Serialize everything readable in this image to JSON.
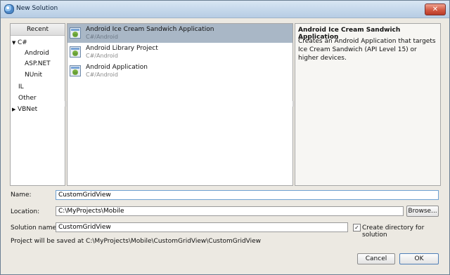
{
  "window": {
    "title": "New Solution",
    "close_glyph": "✕"
  },
  "categories": {
    "header": "Recent",
    "items": [
      {
        "label": "C#",
        "expander": "▼"
      },
      {
        "label": "Android"
      },
      {
        "label": "ASP.NET"
      },
      {
        "label": "NUnit"
      },
      {
        "label": "IL"
      },
      {
        "label": "Other"
      },
      {
        "label": "VBNet",
        "expander": "▶"
      }
    ]
  },
  "templates": [
    {
      "name": "Android Ice Cream Sandwich Application",
      "subtitle": "C#/Android",
      "selected": true,
      "icon": "android-project-icon"
    },
    {
      "name": "Android Library Project",
      "subtitle": "C#/Android",
      "selected": false,
      "icon": "android-project-icon"
    },
    {
      "name": "Android Application",
      "subtitle": "C#/Android",
      "selected": false,
      "icon": "android-project-icon"
    }
  ],
  "description": {
    "title": "Android Ice Cream Sandwich Application",
    "text": "Creates an Android Application that targets Ice Cream Sandwich (API Level 15) or higher devices."
  },
  "form": {
    "name_label": "Name:",
    "name_value": "CustomGridView",
    "location_label": "Location:",
    "location_value": "C:\\MyProjects\\Mobile",
    "browse_label": "Browse...",
    "solution_label": "Solution name:",
    "solution_value": "CustomGridView",
    "create_dir_label": "Create directory for solution",
    "create_dir_checked": true,
    "check_glyph": "✓",
    "save_path_text": "Project will be saved at C:\\MyProjects\\Mobile\\CustomGridView\\CustomGridView"
  },
  "buttons": {
    "cancel": "Cancel",
    "ok": "OK"
  },
  "colors": {
    "selection": "#a9b7c6",
    "title_gradient_top": "#d9e6f3",
    "close_red": "#d25a44"
  }
}
